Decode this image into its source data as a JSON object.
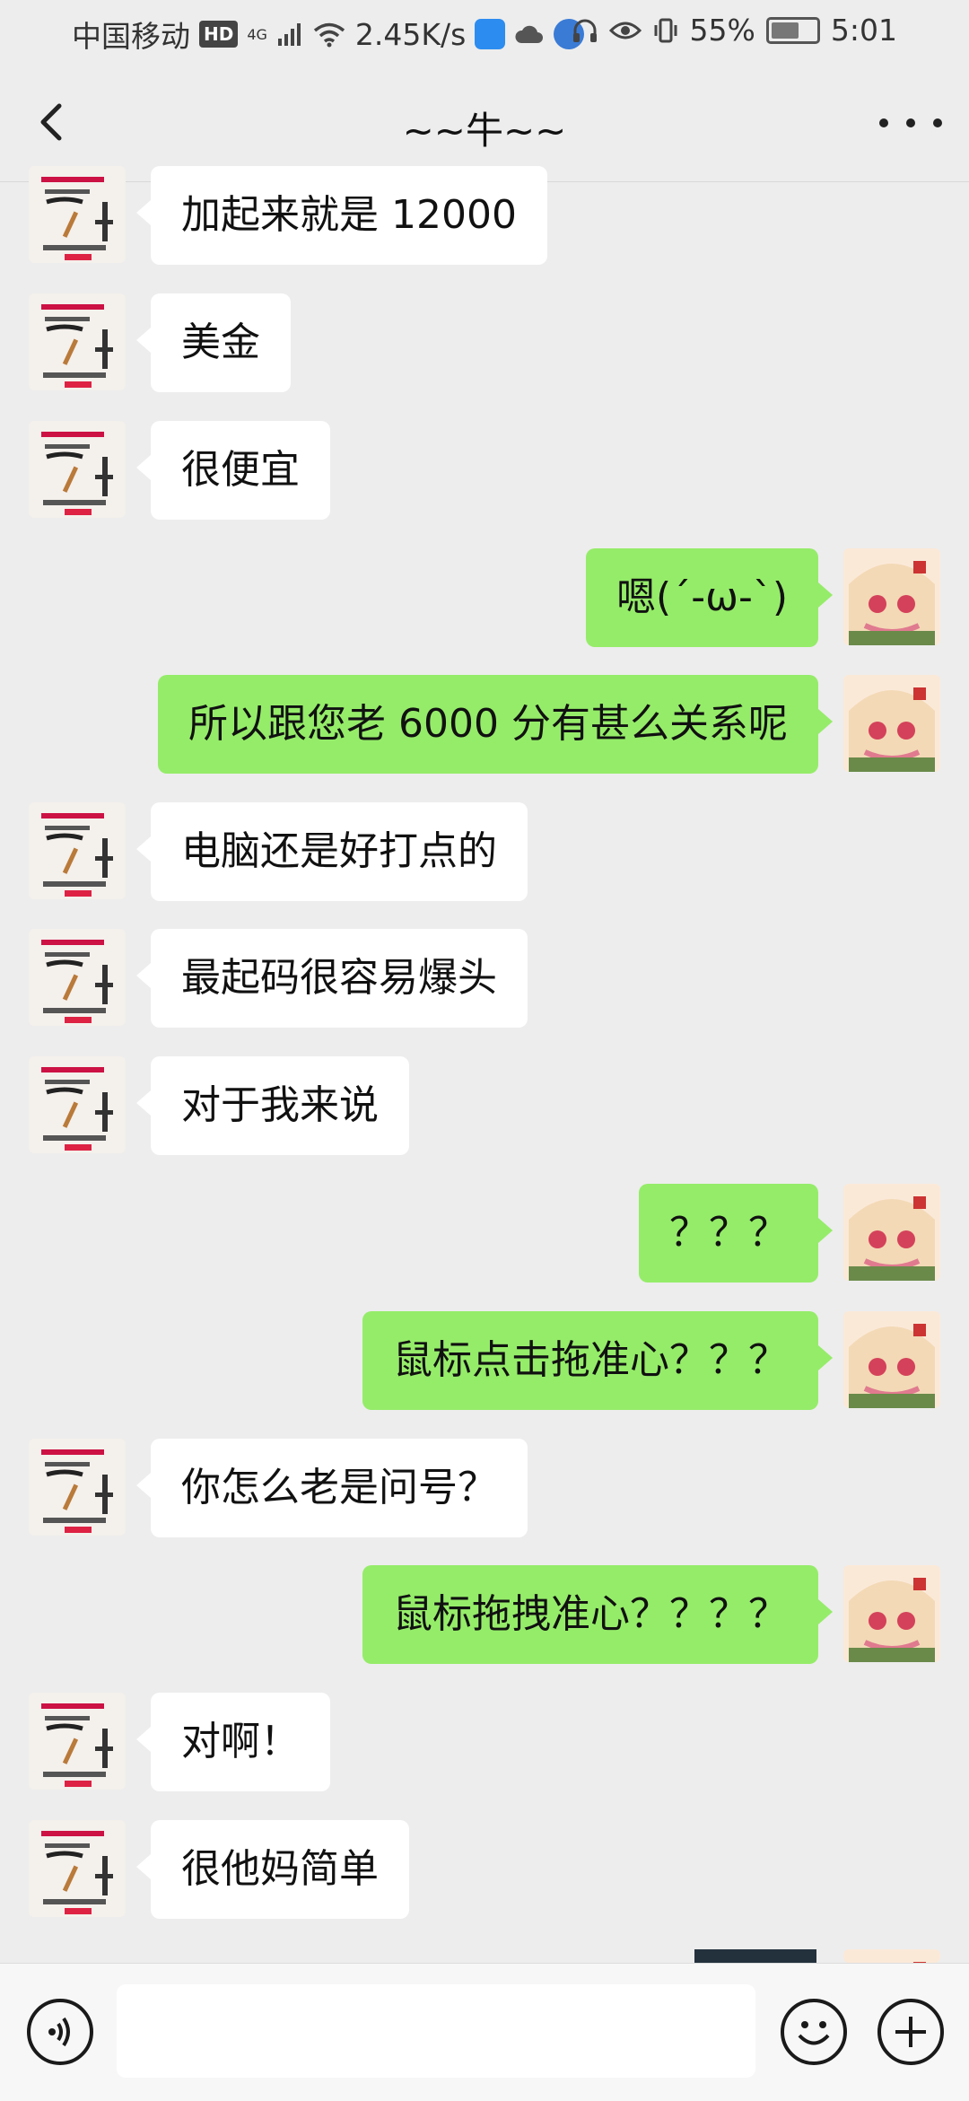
{
  "status_bar": {
    "carrier": "中国移动",
    "hd_badge": "HD",
    "network": "4G",
    "speed": "2.45K/s",
    "battery": "55%",
    "time": "5:01",
    "icons": [
      "hd-icon",
      "signal-icon",
      "wifi-icon",
      "hotspot-app-icon",
      "cloud-icon",
      "browser-app-icon",
      "headphones-icon",
      "eye-icon",
      "vibrate-icon",
      "battery-icon"
    ]
  },
  "header": {
    "title": "~~牛~~",
    "back_icon": "chevron-left-icon",
    "more_icon": "more-dots-icon"
  },
  "messages": [
    {
      "side": "left",
      "text": "加起来就是 12000"
    },
    {
      "side": "left",
      "text": "美金"
    },
    {
      "side": "left",
      "text": "很便宜"
    },
    {
      "side": "right",
      "text": "嗯(´-ω-`)"
    },
    {
      "side": "right",
      "text": "所以跟您老 6000 分有甚么关系呢"
    },
    {
      "side": "left",
      "text": "电脑还是好打点的"
    },
    {
      "side": "left",
      "text": "最起码很容易爆头"
    },
    {
      "side": "left",
      "text": "对于我来说"
    },
    {
      "side": "right",
      "text": "？？？"
    },
    {
      "side": "right",
      "text": "鼠标点击拖准心？？？"
    },
    {
      "side": "left",
      "text": "你怎么老是问号？"
    },
    {
      "side": "right",
      "text": "鼠标拖拽准心？？？？"
    },
    {
      "side": "left",
      "text": "对啊！"
    },
    {
      "side": "left",
      "text": "很他妈简单"
    }
  ],
  "input_bar": {
    "voice_icon": "voice-icon",
    "emoji_icon": "emoji-icon",
    "plus_icon": "plus-icon"
  },
  "colors": {
    "background": "#ededed",
    "sent_bubble": "#95ec69",
    "received_bubble": "#ffffff"
  }
}
